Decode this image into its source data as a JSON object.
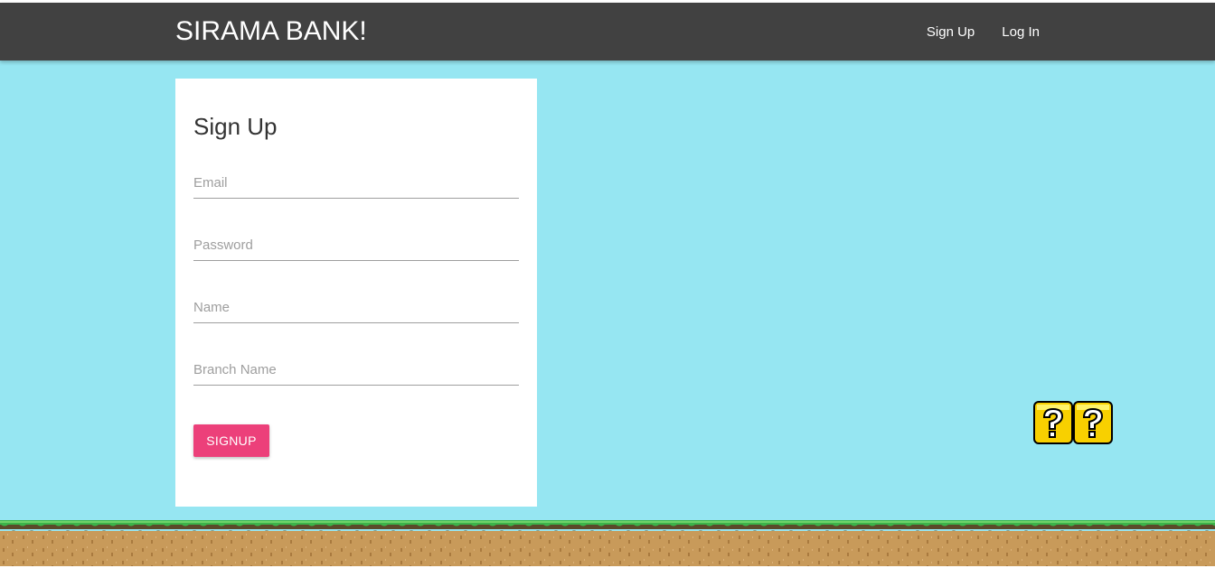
{
  "navbar": {
    "brand": "SIRAMA BANK!",
    "links": [
      "Sign Up",
      "Log In"
    ]
  },
  "signup_form": {
    "title": "Sign Up",
    "fields": {
      "email_placeholder": "Email",
      "password_placeholder": "Password",
      "name_placeholder": "Name",
      "branch_placeholder": "Branch Name"
    },
    "submit_label": "SIGNUP"
  },
  "decor": {
    "question_block_icon": "question-block-icon",
    "ground_icon": "grass-ground-icon"
  },
  "colors": {
    "sky": "#96e6f2",
    "navbar": "#414141",
    "accent": "#ec407a",
    "grass": "#3cb44a",
    "dirt": "#c89a5a"
  }
}
